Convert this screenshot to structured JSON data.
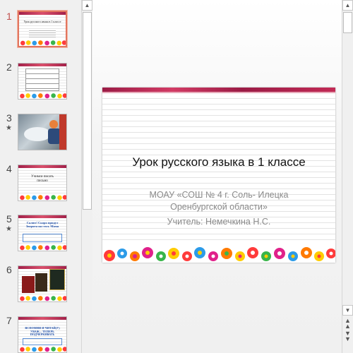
{
  "thumbnails": [
    {
      "number": "1",
      "star": "",
      "title": "Урок русского языка в 1 классе",
      "active": true
    },
    {
      "number": "2",
      "star": ""
    },
    {
      "number": "3",
      "star": "★"
    },
    {
      "number": "4",
      "star": "",
      "title": "Учимся писать письмо"
    },
    {
      "number": "5",
      "star": "★",
      "title": "Салют! Скоро придут Зверята на стол. Мама"
    },
    {
      "number": "6",
      "star": ""
    },
    {
      "number": "7",
      "star": "",
      "title": "ВСПОМНИ И ЧИТАЙ(У) УВАЖ... ТЕПЕРЬ ПОДЧЕРКИВАТЬ"
    }
  ],
  "slide": {
    "title": "Урок русского языка в 1 классе",
    "subtitle_line1": "МОАУ «СОШ № 4 г. Соль- Илецка",
    "subtitle_line2": "Оренбургской области»",
    "teacher": "Учитель: Немечкина Н.С."
  },
  "colors": {
    "accent": "#c0504d",
    "band": "#9b1b45"
  },
  "icons": {
    "scroll_up": "triangle-up",
    "scroll_down": "triangle-down",
    "prev_slide": "double-chevron-up",
    "next_slide": "double-chevron-down"
  }
}
